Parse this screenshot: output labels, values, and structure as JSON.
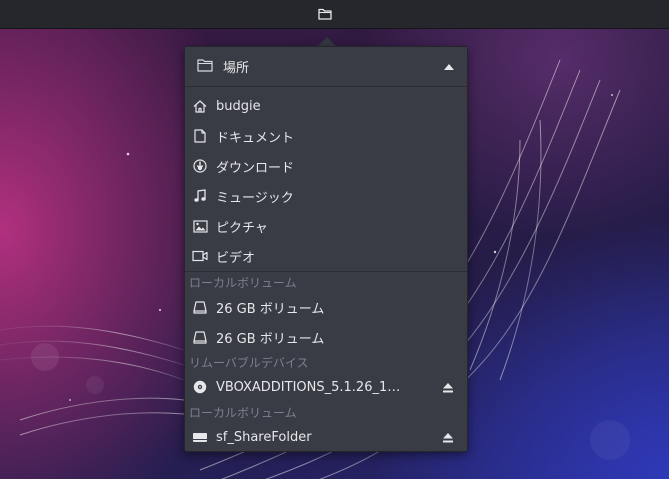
{
  "topbar": {
    "places_icon": "folder-icon"
  },
  "popover": {
    "header": {
      "title": "場所",
      "icon": "folder-icon",
      "toggle_icon": "collapse-up-icon"
    },
    "places": [
      {
        "label": "budgie",
        "icon": "home-icon"
      },
      {
        "label": "ドキュメント",
        "icon": "document-icon"
      },
      {
        "label": "ダウンロード",
        "icon": "download-icon"
      },
      {
        "label": "ミュージック",
        "icon": "music-icon"
      },
      {
        "label": "ピクチャ",
        "icon": "pictures-icon"
      },
      {
        "label": "ビデオ",
        "icon": "video-icon"
      }
    ],
    "local_volumes": {
      "title": "ローカルボリューム",
      "items": [
        {
          "label": "26 GB ボリューム",
          "icon": "drive-icon"
        },
        {
          "label": "26 GB ボリューム",
          "icon": "drive-icon"
        }
      ]
    },
    "removable": {
      "title": "リムーバブルデバイス",
      "items": [
        {
          "label": "VBOXADDITIONS_5.1.26_1…",
          "icon": "optical-disc-icon",
          "eject_icon": "eject-icon"
        }
      ]
    },
    "network_volumes": {
      "title": "ローカルボリューム",
      "items": [
        {
          "label": "sf_ShareFolder",
          "icon": "network-drive-icon",
          "eject_icon": "eject-icon"
        }
      ]
    }
  }
}
